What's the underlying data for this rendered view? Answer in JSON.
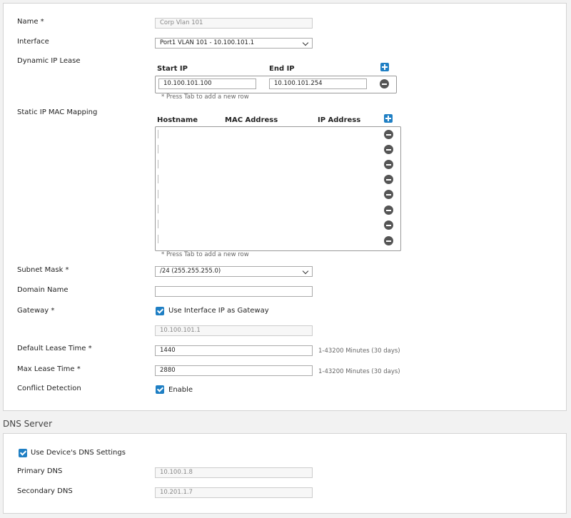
{
  "form": {
    "name_label": "Name *",
    "name_value": "Corp Vlan 101",
    "interface_label": "Interface",
    "interface_value": "Port1 VLAN 101 - 10.100.101.1",
    "dynamic_lease_label": "Dynamic IP Lease",
    "start_ip_header": "Start IP",
    "end_ip_header": "End IP",
    "start_ip_value": "10.100.101.100",
    "end_ip_value": "10.100.101.254",
    "press_tab_hint": "* Press Tab to add a new row",
    "static_mapping_label": "Static IP MAC Mapping",
    "hostname_header": "Hostname",
    "mac_header": "MAC Address",
    "ip_header": "IP Address",
    "press_tab_hint_2": "* Press Tab to add a new row",
    "subnet_label": "Subnet Mask *",
    "subnet_value": "/24 (255.255.255.0)",
    "domain_label": "Domain Name",
    "domain_value": "",
    "gateway_label": "Gateway *",
    "gateway_checkbox_label": "Use Interface IP as Gateway",
    "gateway_checked": true,
    "gateway_value": "10.100.101.1",
    "default_lease_label": "Default Lease Time *",
    "default_lease_value": "1440",
    "default_lease_hint": "1-43200 Minutes (30 days)",
    "max_lease_label": "Max Lease Time *",
    "max_lease_value": "2880",
    "max_lease_hint": "1-43200 Minutes (30 days)",
    "conflict_label": "Conflict Detection",
    "conflict_checkbox_label": "Enable",
    "conflict_checked": true
  },
  "dns": {
    "section_title": "DNS Server",
    "use_device_label": "Use Device's DNS Settings",
    "use_device_checked": true,
    "primary_label": "Primary DNS",
    "primary_value": "10.100.1.8",
    "secondary_label": "Secondary DNS",
    "secondary_value": "10.201.1.7"
  },
  "icons": {
    "add": "plus-icon",
    "remove": "minus-circle-icon",
    "check": "checkbox-checked-icon",
    "dropdown": "chevron-down-icon"
  },
  "colors": {
    "accent": "#1f7fc4",
    "remove_icon": "#555555",
    "background": "#f2f2f2"
  }
}
